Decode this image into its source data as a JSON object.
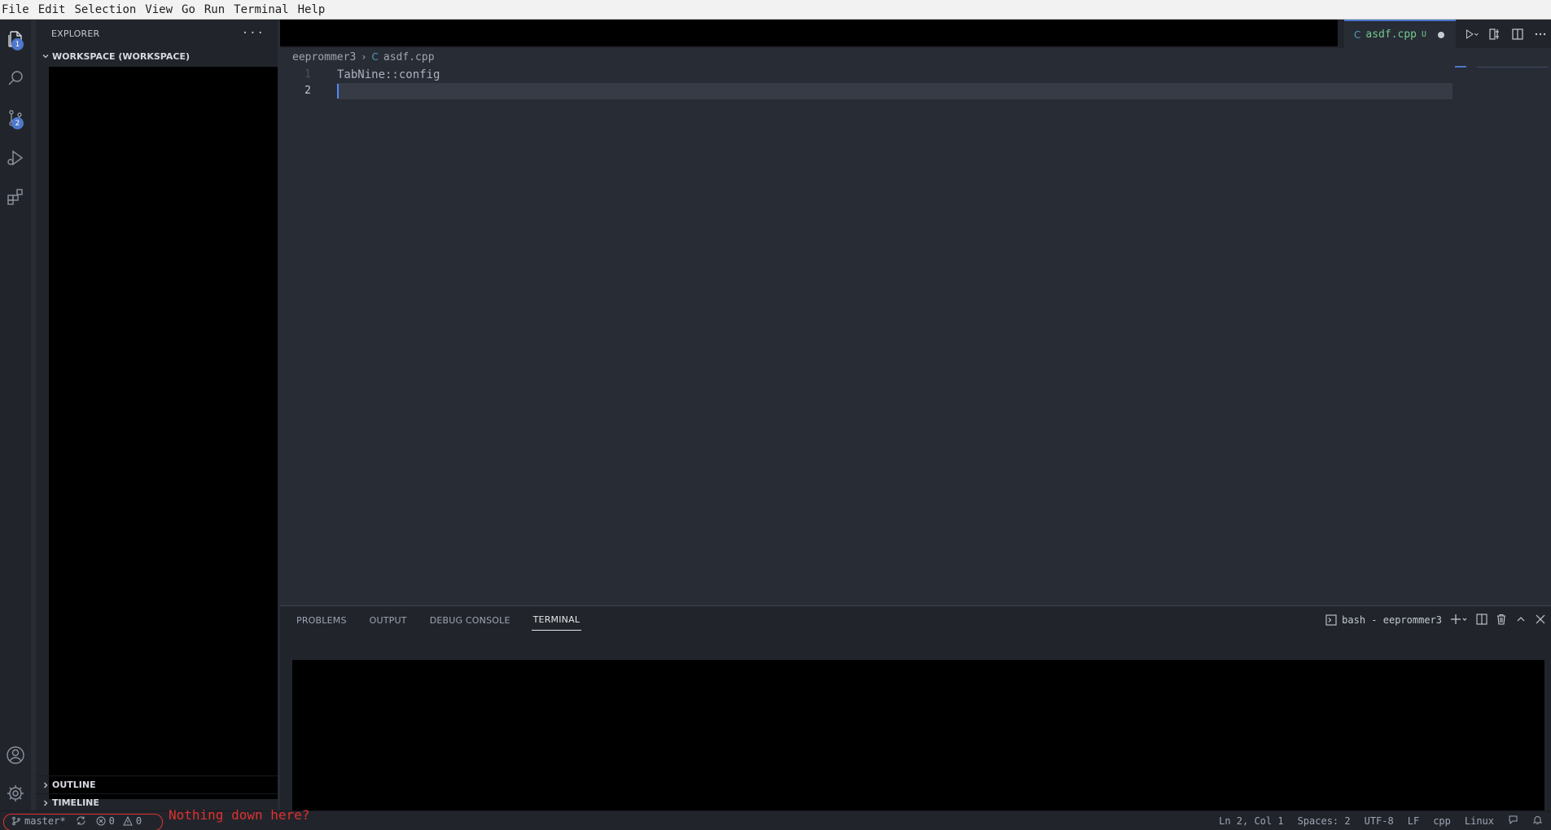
{
  "menubar": {
    "items": [
      "File",
      "Edit",
      "Selection",
      "View",
      "Go",
      "Run",
      "Terminal",
      "Help"
    ]
  },
  "activitybar": {
    "items": [
      {
        "icon": "files-icon",
        "badge": "1"
      },
      {
        "icon": "search-icon"
      },
      {
        "icon": "source-control-icon",
        "badge": "2"
      },
      {
        "icon": "run-debug-icon"
      },
      {
        "icon": "extensions-icon"
      }
    ],
    "bottom": [
      {
        "icon": "account-icon"
      },
      {
        "icon": "gear-icon"
      }
    ]
  },
  "sidebar": {
    "title": "EXPLORER",
    "more": "···",
    "workspace": "WORKSPACE (WORKSPACE)",
    "outline": "OUTLINE",
    "timeline": "TIMELINE"
  },
  "editor": {
    "tab": {
      "label": "asdf.cpp",
      "status": "U",
      "icon": "C"
    },
    "breadcrumb": {
      "folder": "eeprommer3",
      "file": "asdf.cpp",
      "icon": "C"
    },
    "lines": [
      {
        "num": "1",
        "text": "TabNine::config"
      },
      {
        "num": "2",
        "text": ""
      }
    ]
  },
  "panel": {
    "tabs": [
      "PROBLEMS",
      "OUTPUT",
      "DEBUG CONSOLE",
      "TERMINAL"
    ],
    "active_tab": "TERMINAL",
    "terminal_name": "bash - eeprommer3"
  },
  "statusbar": {
    "branch": "master*",
    "errors": "0",
    "warnings": "0",
    "annotation": "Nothing down here?",
    "position": "Ln 2, Col 1",
    "spaces": "Spaces: 2",
    "encoding": "UTF-8",
    "eol": "LF",
    "language": "cpp",
    "os": "Linux"
  },
  "colors": {
    "accent": "#4d78cc",
    "annotation": "#e03030",
    "untracked": "#73c991"
  }
}
